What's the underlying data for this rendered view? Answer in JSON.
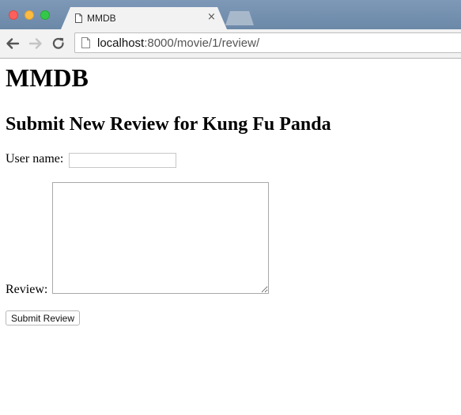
{
  "browser": {
    "tab_title": "MMDB",
    "tab_close": "×",
    "url_host": "localhost",
    "url_rest": ":8000/movie/1/review/"
  },
  "page": {
    "site_title": "MMDB",
    "heading": "Submit New Review for Kung Fu Panda"
  },
  "form": {
    "user_label": "User name:",
    "user_value": "",
    "review_label": "Review:",
    "review_value": "",
    "submit_label": "Submit Review"
  }
}
